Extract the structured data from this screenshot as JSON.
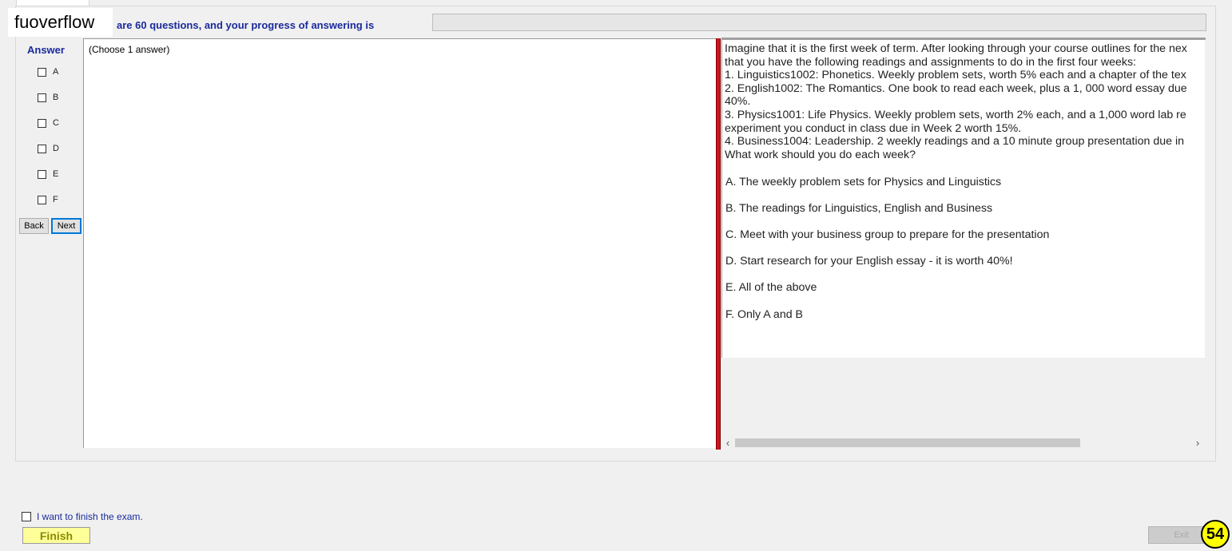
{
  "watermark": "fuoverflow",
  "header": {
    "progress_label": "are 60 questions, and your progress of answering is",
    "progress_fraction": 0
  },
  "answer_panel": {
    "title": "Answer",
    "options": [
      "A",
      "B",
      "C",
      "D",
      "E",
      "F"
    ],
    "back_label": "Back",
    "next_label": "Next",
    "instruction": "(Choose 1 answer)"
  },
  "question": {
    "lines": [
      "Imagine that it is the first week of term. After looking through your course outlines for the nex",
      "that you have the following readings and assignments to do in the first four weeks:",
      "1. Linguistics1002: Phonetics. Weekly problem sets, worth 5% each and a chapter of the tex",
      "2. English1002: The Romantics. One book to read each week, plus a 1, 000 word essay due",
      "40%.",
      "3. Physics1001: Life Physics. Weekly problem sets, worth 2% each, and a 1,000 word lab re",
      "experiment you conduct in class due in Week 2 worth 15%.",
      "4. Business1004: Leadership. 2 weekly readings and a 10 minute group presentation due in",
      "What work should you do each week?"
    ],
    "choices": [
      "A.  The weekly problem sets for Physics and Linguistics",
      "B.  The readings for Linguistics, English and Business",
      "C.  Meet with your business group to prepare for the presentation",
      "D.  Start research for your English essay - it is worth 40%!",
      "E.  All of the above",
      "F.  Only A and B"
    ]
  },
  "footer": {
    "finish_check_label": "I want to finish the exam.",
    "finish_label": "Finish",
    "exit_label": "Exit",
    "question_number": "54"
  },
  "colors": {
    "accent_blue": "#1a2a9c",
    "splitter_red": "#d2141c",
    "finish_yellow": "#ffff99",
    "badge_yellow": "#ffff00"
  }
}
